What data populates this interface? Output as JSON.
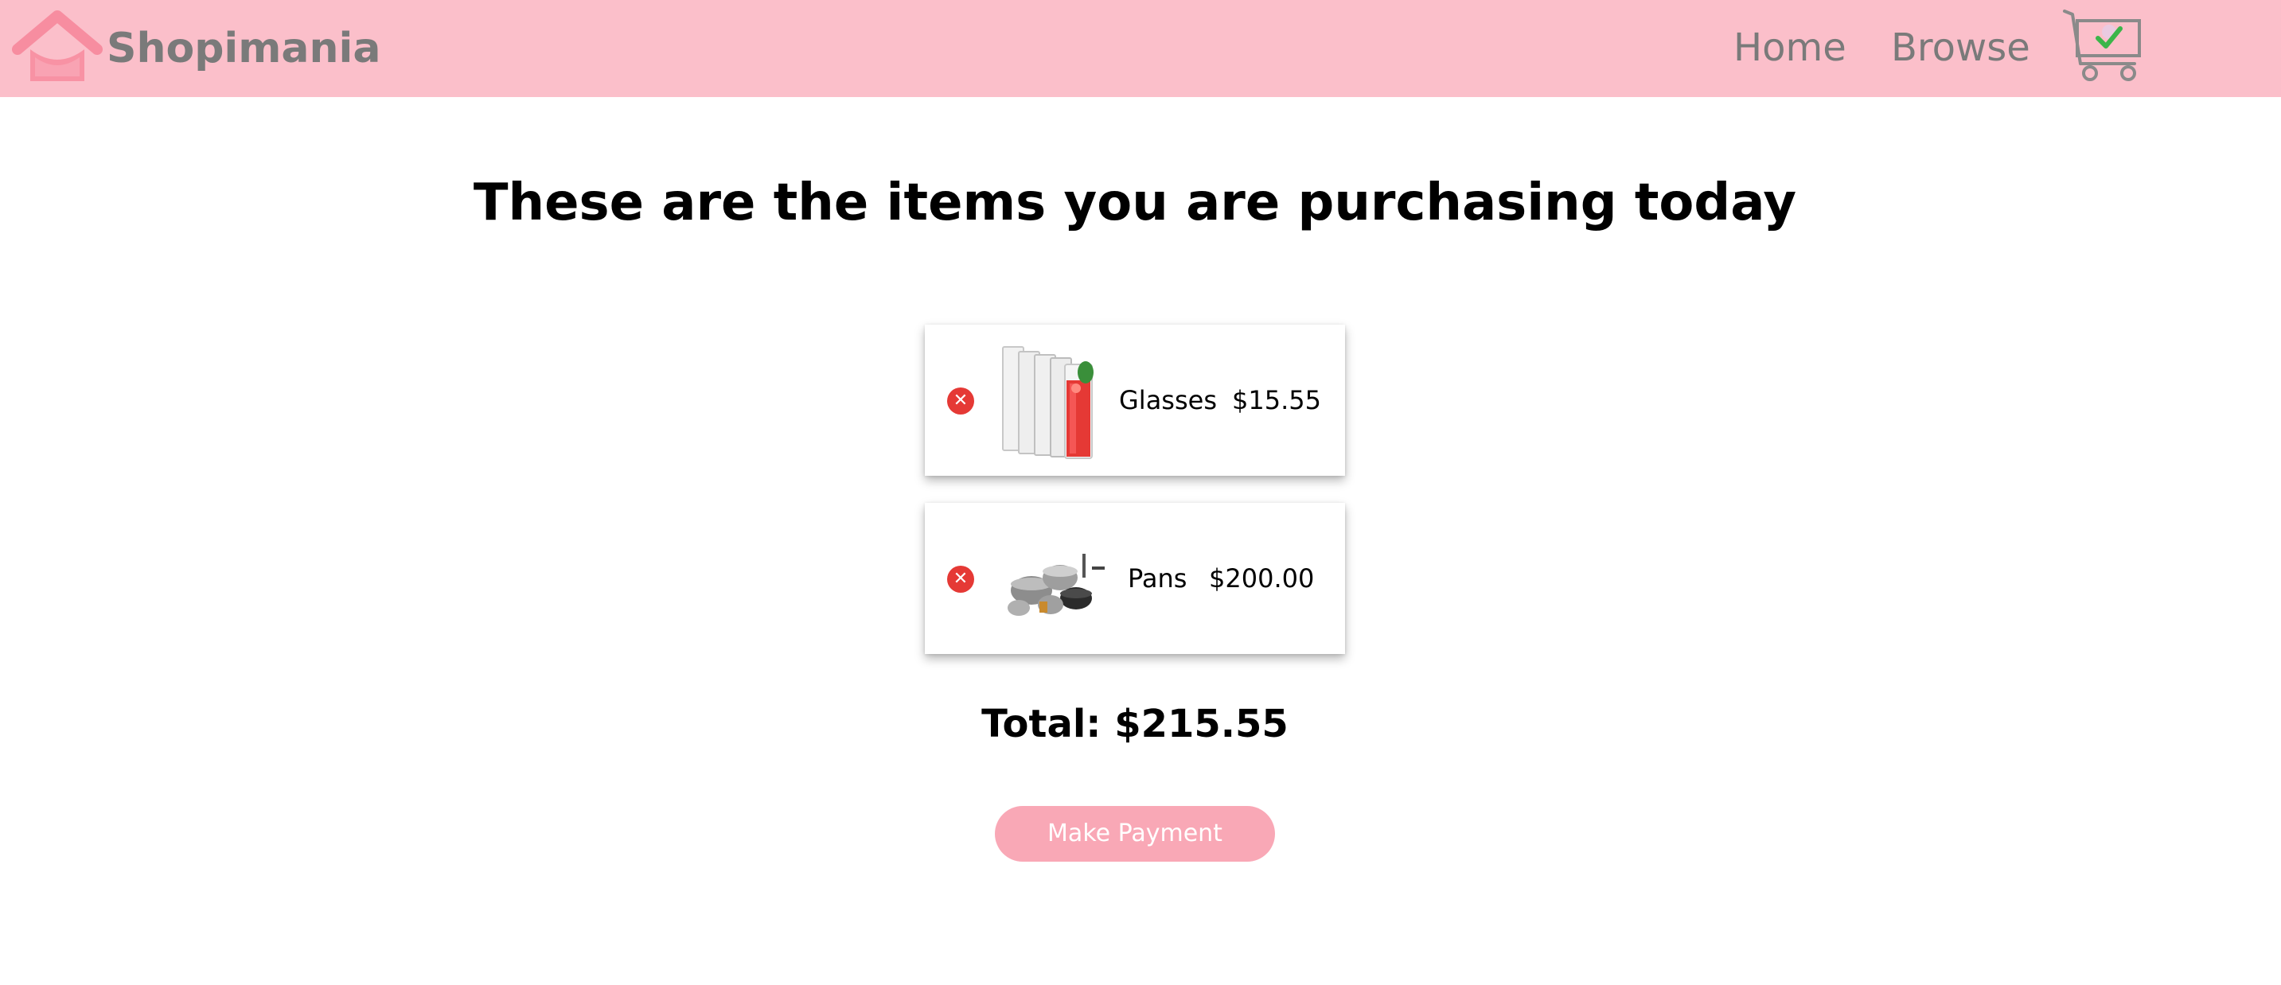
{
  "brand": {
    "name": "Shopimania",
    "logo_icon": "house-icon",
    "color": "#7a7a7a"
  },
  "nav": {
    "links": [
      "Home",
      "Browse"
    ],
    "cart_icon": "cart-check-icon"
  },
  "heading": "These are the items you are purchasing today",
  "cart": {
    "items": [
      {
        "name": "Glasses",
        "price": "$15.55",
        "remove_icon": "close-icon",
        "image": "glasses-image"
      },
      {
        "name": "Pans",
        "price": "$200.00",
        "remove_icon": "close-icon",
        "image": "pans-image"
      }
    ],
    "total_label": "Total:",
    "total_value": "$215.55"
  },
  "actions": {
    "pay_label": "Make Payment"
  },
  "colors": {
    "navbar": "#fbbfca",
    "accent": "#f9a8b6",
    "remove": "#e53935",
    "logo": "#f78da0"
  }
}
